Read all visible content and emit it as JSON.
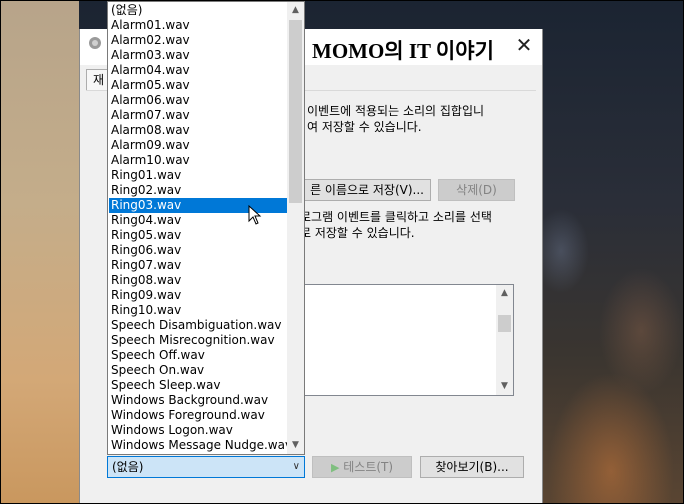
{
  "window": {
    "title": "MOMO의 IT 이야기",
    "close_label": "✕",
    "tab_label": "재"
  },
  "description_top": "이벤트에 적용되는 소리의 집합입니\n여 저장할 수 있습니다.",
  "buttons": {
    "save_as": "른 이름으로 저장(V)...",
    "delete": "삭제(D)",
    "test": "테스트(T)",
    "browse": "찾아보기(B)..."
  },
  "description_mid": "로그램 이벤트를 클릭하고 소리를 선택\n로 저장할 수 있습니다.",
  "sound_dropdown": {
    "selected_value": "(없음)",
    "highlighted": "Ring03.wav",
    "options": [
      "(없음)",
      "Alarm01.wav",
      "Alarm02.wav",
      "Alarm03.wav",
      "Alarm04.wav",
      "Alarm05.wav",
      "Alarm06.wav",
      "Alarm07.wav",
      "Alarm08.wav",
      "Alarm09.wav",
      "Alarm10.wav",
      "Ring01.wav",
      "Ring02.wav",
      "Ring03.wav",
      "Ring04.wav",
      "Ring05.wav",
      "Ring06.wav",
      "Ring07.wav",
      "Ring08.wav",
      "Ring09.wav",
      "Ring10.wav",
      "Speech Disambiguation.wav",
      "Speech Misrecognition.wav",
      "Speech Off.wav",
      "Speech On.wav",
      "Speech Sleep.wav",
      "Windows Background.wav",
      "Windows Foreground.wav",
      "Windows Logon.wav",
      "Windows Message Nudge.wav"
    ]
  },
  "icons": {
    "app": "speaker-icon",
    "play": "play-icon",
    "chevron": "chevron-down-icon",
    "cursor": "mouse-pointer-icon"
  },
  "colors": {
    "selection": "#0078d7",
    "combo_focus": "#cce4f7"
  }
}
